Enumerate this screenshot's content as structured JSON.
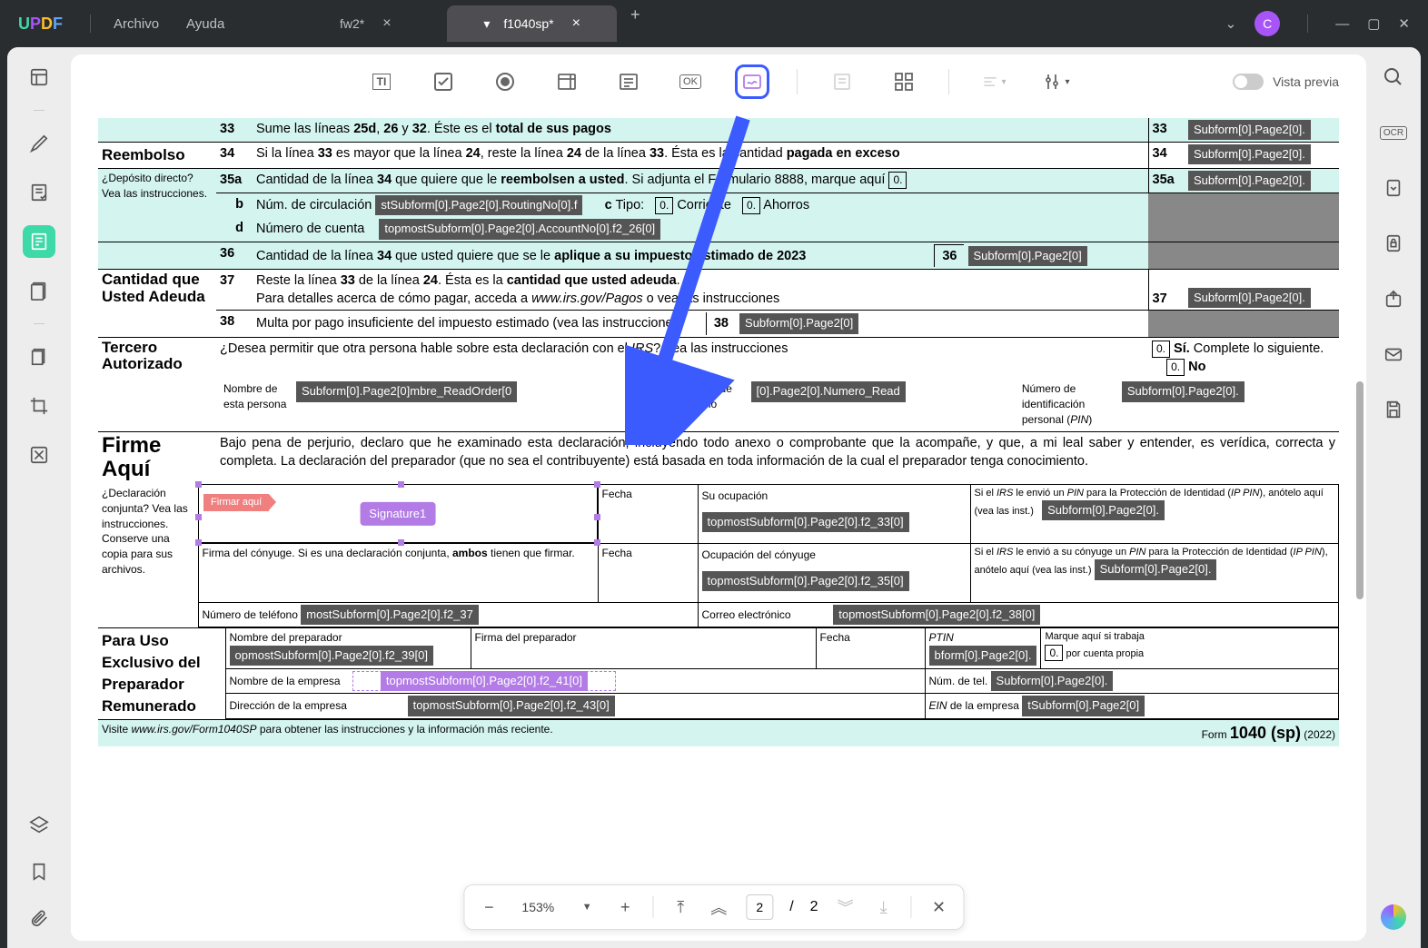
{
  "app": {
    "name": "UPDF",
    "menus": [
      "Archivo",
      "Ayuda"
    ],
    "avatar": "C"
  },
  "tabs": [
    {
      "title": "fw2*",
      "active": false
    },
    {
      "title": "f1040sp*",
      "active": true
    }
  ],
  "toolbar": {
    "preview_label": "Vista previa"
  },
  "page_controls": {
    "zoom": "153%",
    "page_current": "2",
    "page_separator": "/",
    "page_total": "2"
  },
  "form": {
    "rows": {
      "r33": {
        "num": "33",
        "text_a": "Sume las líneas ",
        "b1": "25d",
        "sep1": ", ",
        "b2": "26",
        "sep2": " y ",
        "b3": "32",
        "text_b": ". Éste es el ",
        "b4": "total de sus pagos",
        "boxnum": "33",
        "field": "Subform[0].Page2[0]."
      },
      "reembolso": "Reembolso",
      "r34": {
        "num": "34",
        "text": "Si la línea 33 es mayor que la línea 24, reste la línea 24 de la línea 33. Ésta es la cantidad pagada en exceso",
        "boxnum": "34",
        "field": "Subform[0].Page2[0]."
      },
      "r35a": {
        "num": "35a",
        "text_a": "Cantidad de la línea ",
        "b1": "34",
        "text_b": " que quiere que le ",
        "b2": "reembolsen a usted",
        "text_c": ". Si adjunta el Formulario 8888, marque aquí",
        "boxmark": "0.",
        "boxnum": "35a",
        "field": "Subform[0].Page2[0]."
      },
      "deposit_note": "¿Depósito directo? Vea las instrucciones.",
      "rb": {
        "num": "b",
        "label": "Núm. de circulación",
        "field": "stSubform[0].Page2[0].RoutingNo[0].f",
        "c_label": "c",
        "tipo": "Tipo:",
        "m1": "0.",
        "corr": "Corriente",
        "m2": "0.",
        "ahorros": "Ahorros"
      },
      "rd": {
        "num": "d",
        "label": "Número de cuenta",
        "field": "topmostSubform[0].Page2[0].AccountNo[0].f2_26[0]"
      },
      "r36": {
        "num": "36",
        "text_a": "Cantidad de la línea ",
        "b1": "34",
        "text_b": " que usted quiere que se le ",
        "b2": "aplique a su impuesto estimado de 2023",
        "boxnum": "36",
        "field": "Subform[0].Page2[0]"
      },
      "cantidad_adeuda": "Cantidad que Usted Adeuda",
      "r37": {
        "num": "37",
        "text_a": "Reste la línea ",
        "b1": "33",
        "text_b": " de la línea ",
        "b2": "24",
        "text_c": ". Ésta es la ",
        "b3": "cantidad que usted adeuda",
        "text_d": ".",
        "detail": "Para detalles acerca de cómo pagar, acceda a ",
        "link": "www.irs.gov/Pagos",
        "detail2": " o vea las instrucciones",
        "boxnum": "37",
        "field": "Subform[0].Page2[0]."
      },
      "r38": {
        "num": "38",
        "text": "Multa por pago insuficiente del impuesto estimado (vea las instrucciones)",
        "boxnum": "38",
        "field": "Subform[0].Page2[0]"
      },
      "tercero": "Tercero Autorizado",
      "tercero_q": "¿Desea permitir que otra persona hable sobre esta declaración con el ",
      "irs": "IRS",
      "tercero_q2": "? Vea las instrucciones",
      "si_mark": "0.",
      "si": "Sí.",
      "si_text": " Complete lo siguiente.",
      "no_mark": "0.",
      "no": "No",
      "nombre_persona": "Nombre de esta persona",
      "nombre_field": "Subform[0].Page2[0]mbre_ReadOrder[0",
      "numero_tel": "Número de teléfono",
      "numero_field": "[0].Page2[0].Numero_Read",
      "pin_label": "Número de identificación personal (PIN)",
      "pin_field": "Subform[0].Page2[0].",
      "firme_aqui": "Firme Aquí",
      "perjurio": "Bajo pena de perjurio, declaro que he examinado esta declaración, incluyendo todo anexo o comprobante que la acompañe, y que, a mi leal saber y entender, es verídica, correcta y completa. La declaración del preparador (que no sea el contribuyente) está basada en toda información de la cual el preparador tenga conocimiento.",
      "decl_conjunta": "¿Declaración conjunta? Vea las instrucciones. Conserve una copia para sus archivos.",
      "firmar_aqui_tag": "Firmar aquí",
      "signature_badge": "Signature1",
      "fecha": "Fecha",
      "ocupacion": "Su ocupación",
      "ocup_field": "topmostSubform[0].Page2[0].f2_33[0]",
      "ip_pin_text": "Si el IRS le envió un PIN para la Protección de Identidad (IP PIN), anótelo aquí (vea las inst.)",
      "ip_pin_field": "Subform[0].Page2[0].",
      "firma_conyuge": "Firma del cónyuge. Si es una declaración conjunta, ambos tienen que firmar.",
      "ocup_conyuge": "Ocupación del cónyuge",
      "ocup_conyuge_field": "topmostSubform[0].Page2[0].f2_35[0]",
      "ip_pin_conyuge": "Si el IRS le envió a su cónyuge un PIN para la Protección de Identidad (IP PIN), anótelo aquí (vea las inst.)",
      "num_tel": "Número de teléfono",
      "tel_field": "mostSubform[0].Page2[0].f2_37",
      "correo": "Correo electrónico",
      "correo_field": "topmostSubform[0].Page2[0].f2_38[0]",
      "preparador_header": "Para Uso Exclusivo del Preparador Remunerado",
      "nombre_prep": "Nombre del preparador",
      "nombre_prep_field": "opmostSubform[0].Page2[0].f2_39[0]",
      "firma_prep": "Firma del preparador",
      "ptin": "PTIN",
      "ptin_field": "bform[0].Page2[0].",
      "marque": "Marque aquí si trabaja",
      "marque_mark": "0.",
      "por_cuenta": "por cuenta propia",
      "nombre_empresa": "Nombre de la empresa",
      "empresa_field": "topmostSubform[0].Page2[0].f2_41[0]",
      "num_tel_emp": "Núm. de tel.",
      "num_tel_emp_field": "Subform[0].Page2[0].",
      "dir_empresa": "Dirección de la empresa",
      "dir_field": "topmostSubform[0].Page2[0].f2_43[0]",
      "ein": "EIN de la empresa",
      "ein_field": "tSubform[0].Page2[0]",
      "footer_a": "Visite ",
      "footer_link": "www.irs.gov/Form1040SP",
      "footer_b": " para obtener las instrucciones y la información más reciente.",
      "form_no_a": "Form ",
      "form_no_b": "1040 (sp)",
      "form_year": " (2022)"
    }
  }
}
